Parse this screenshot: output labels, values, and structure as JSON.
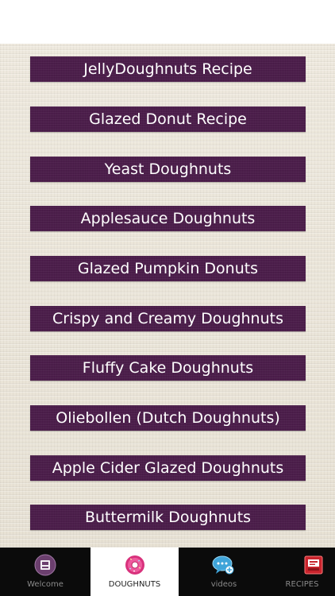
{
  "recipes": [
    {
      "label": "JellyDoughnuts Recipe"
    },
    {
      "label": "Glazed Donut Recipe"
    },
    {
      "label": "Yeast Doughnuts"
    },
    {
      "label": "Applesauce Doughnuts"
    },
    {
      "label": "Glazed Pumpkin Donuts"
    },
    {
      "label": "Crispy and Creamy Doughnuts"
    },
    {
      "label": "Fluffy Cake Doughnuts"
    },
    {
      "label": "Oliebollen (Dutch Doughnuts)"
    },
    {
      "label": "Apple Cider Glazed Doughnuts"
    },
    {
      "label": "Buttermilk Doughnuts"
    }
  ],
  "tabs": [
    {
      "label": "Welcome",
      "icon": "welcome-icon",
      "active": false
    },
    {
      "label": "DOUGHNUTS",
      "icon": "donut-icon",
      "active": true
    },
    {
      "label": "videos",
      "icon": "chat-bubble-icon",
      "active": false
    },
    {
      "label": "RECIPES",
      "icon": "recipe-book-icon",
      "active": false
    }
  ],
  "colors": {
    "button_bg": "#4c1e4b",
    "button_text": "#ffffff",
    "background": "#ebe6da",
    "tab_bar": "#0b0b0b",
    "active_tab": "#ffffff"
  }
}
